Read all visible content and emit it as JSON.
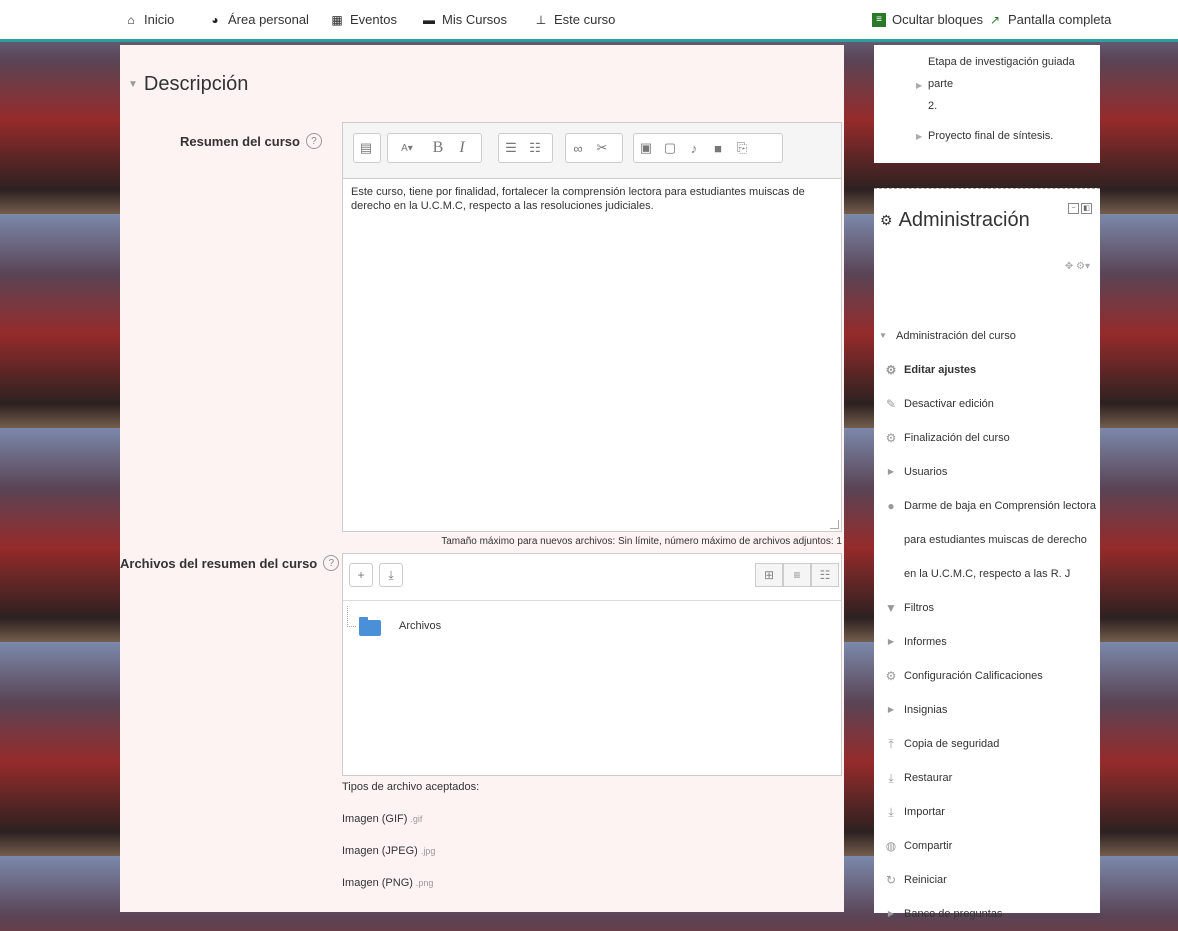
{
  "nav": {
    "left": [
      {
        "label": "Inicio",
        "icon": "home-icon"
      },
      {
        "label": "Área personal",
        "icon": "dashboard-icon"
      },
      {
        "label": "Eventos",
        "icon": "calendar-icon"
      },
      {
        "label": "Mis Cursos",
        "icon": "briefcase-icon"
      },
      {
        "label": "Este curso",
        "icon": "sitemap-icon"
      }
    ],
    "hide_blocks": "Ocultar bloques",
    "fullscreen": "Pantalla completa"
  },
  "main": {
    "section_title": "Descripción",
    "summary_label": "Resumen del curso",
    "summary_text": "Este curso, tiene por finalidad,  fortalecer la comprensión lectora para estudiantes muiscas de derecho en la U.C.M.C, respecto a las resoluciones judiciales.",
    "files_label": "Archivos del resumen del curso",
    "files_info": "Tamaño máximo para nuevos archivos: Sin límite, número máximo de archivos adjuntos: 1",
    "folder_name": "Archivos",
    "accepted_label": "Tipos de archivo aceptados:",
    "accepted": [
      {
        "name": "Imagen (GIF)",
        "ext": ".gif"
      },
      {
        "name": "Imagen (JPEG)",
        "ext": ".jpg"
      },
      {
        "name": "Imagen (PNG)",
        "ext": ".png"
      }
    ]
  },
  "sidebar_top": {
    "item1_line1": "Etapa de investigación guiada parte",
    "item1_line2": "2.",
    "item2": "Proyecto final de síntesis."
  },
  "admin": {
    "title": "Administración",
    "items": [
      {
        "label": "Administración del curso",
        "icon": "caret-down-icon"
      },
      {
        "label": "Editar ajustes",
        "icon": "gear-icon",
        "bold": true
      },
      {
        "label": "Desactivar edición",
        "icon": "pencil-icon"
      },
      {
        "label": "Finalización del curso",
        "icon": "gear-icon"
      },
      {
        "label": "Usuarios",
        "icon": "caret-right-icon"
      },
      {
        "label": "Darme de baja en Comprensión lectora",
        "icon": "user-icon"
      },
      {
        "label": "para estudiantes muiscas de derecho",
        "icon": ""
      },
      {
        "label": "en la U.C.M.C, respecto a las R. J",
        "icon": ""
      },
      {
        "label": "Filtros",
        "icon": "filter-icon"
      },
      {
        "label": "Informes",
        "icon": "caret-right-icon"
      },
      {
        "label": "Configuración Calificaciones",
        "icon": "gear-icon"
      },
      {
        "label": "Insignias",
        "icon": "caret-right-icon"
      },
      {
        "label": "Copia de seguridad",
        "icon": "upload-icon"
      },
      {
        "label": "Restaurar",
        "icon": "download-icon"
      },
      {
        "label": "Importar",
        "icon": "download-icon"
      },
      {
        "label": "Compartir",
        "icon": "share-icon"
      },
      {
        "label": "Reiniciar",
        "icon": "refresh-icon"
      },
      {
        "label": "Banco de preguntas",
        "icon": "caret-right-icon"
      }
    ]
  }
}
